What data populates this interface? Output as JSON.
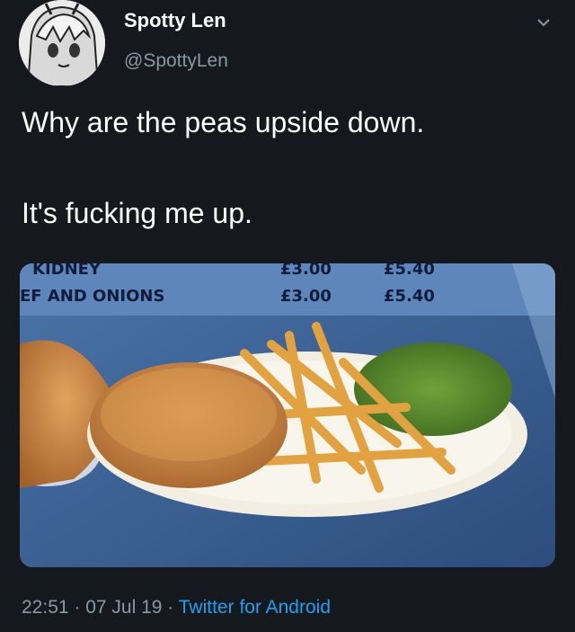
{
  "user": {
    "display_name": "Spotty Len",
    "handle": "@SpottyLen",
    "avatar_icon": "anime-avatar-icon"
  },
  "tweet": {
    "line1": "Why are the peas upside down.",
    "line2": "It's fucking me up."
  },
  "photo": {
    "menu_row1_item": "KIDNEY",
    "menu_row1_price1": "£3.00",
    "menu_row1_price2": "£5.40",
    "menu_row2_item": "EF AND ONIONS",
    "menu_row2_price1": "£3.00",
    "menu_row2_price2": "£5.40"
  },
  "meta": {
    "time": "22:51",
    "sep1": " · ",
    "date": "07 Jul 19",
    "sep2": " · ",
    "source": "Twitter for Android"
  },
  "colors": {
    "background": "#15181c",
    "secondary_text": "#8899a6",
    "link": "#1da1f2"
  }
}
